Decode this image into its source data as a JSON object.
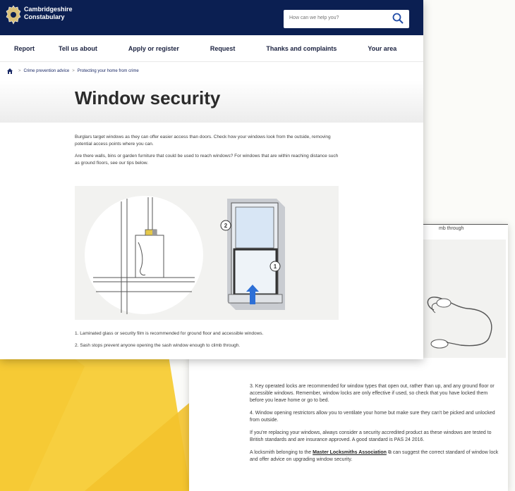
{
  "header": {
    "brand_line1": "Cambridgeshire",
    "brand_line2": "Constabulary",
    "search_placeholder": "How can we help you?"
  },
  "nav": {
    "items": [
      "Report",
      "Tell us about",
      "Apply or register",
      "Request",
      "Thanks and complaints",
      "Your area"
    ]
  },
  "breadcrumb": {
    "items": [
      "Crime prevention advice",
      "Protecting your home from crime"
    ]
  },
  "page": {
    "title": "Window security",
    "intro1": "Burglars target windows as they can offer easier access than doors. Check how your windows look from the outside, removing potential access points where you can.",
    "intro2": "Are there walls, bins or garden furniture that could be used to reach windows? For windows that are within reaching distance such as ground floors, see our tips below.",
    "callout1": "1",
    "callout2": "2",
    "tip1": "1. Laminated glass or security film is recommended for ground floor and accessible windows.",
    "tip2": "2. Sash stops prevent anyone opening the sash window enough to climb through."
  },
  "back_page": {
    "climb_fragment": "mb through",
    "tip3": "3. Key operated locks are recommended for window types that open out, rather than up, and any ground floor or accessible windows. Remember, window locks are only effective if used, so check that you have locked them before you leave home or go to bed.",
    "tip4": "4. Window opening restrictors allow you to ventilate your home but make sure they can't be picked and unlocked from outside.",
    "replacing": "If you're replacing your windows, always consider a security accredited product as these windows are tested to British standards and are insurance approved. A good standard is PAS 24 2016.",
    "locksmith_before": "A locksmith belonging to the",
    "locksmith_link": "Master Locksmiths Association",
    "locksmith_after": "can suggest the correct standard of window lock and offer advice on upgrading window security."
  },
  "colors": {
    "navy": "#0b1f52",
    "yellow": "#f7cf3f",
    "callout_arrow": "#2d6fd6"
  }
}
